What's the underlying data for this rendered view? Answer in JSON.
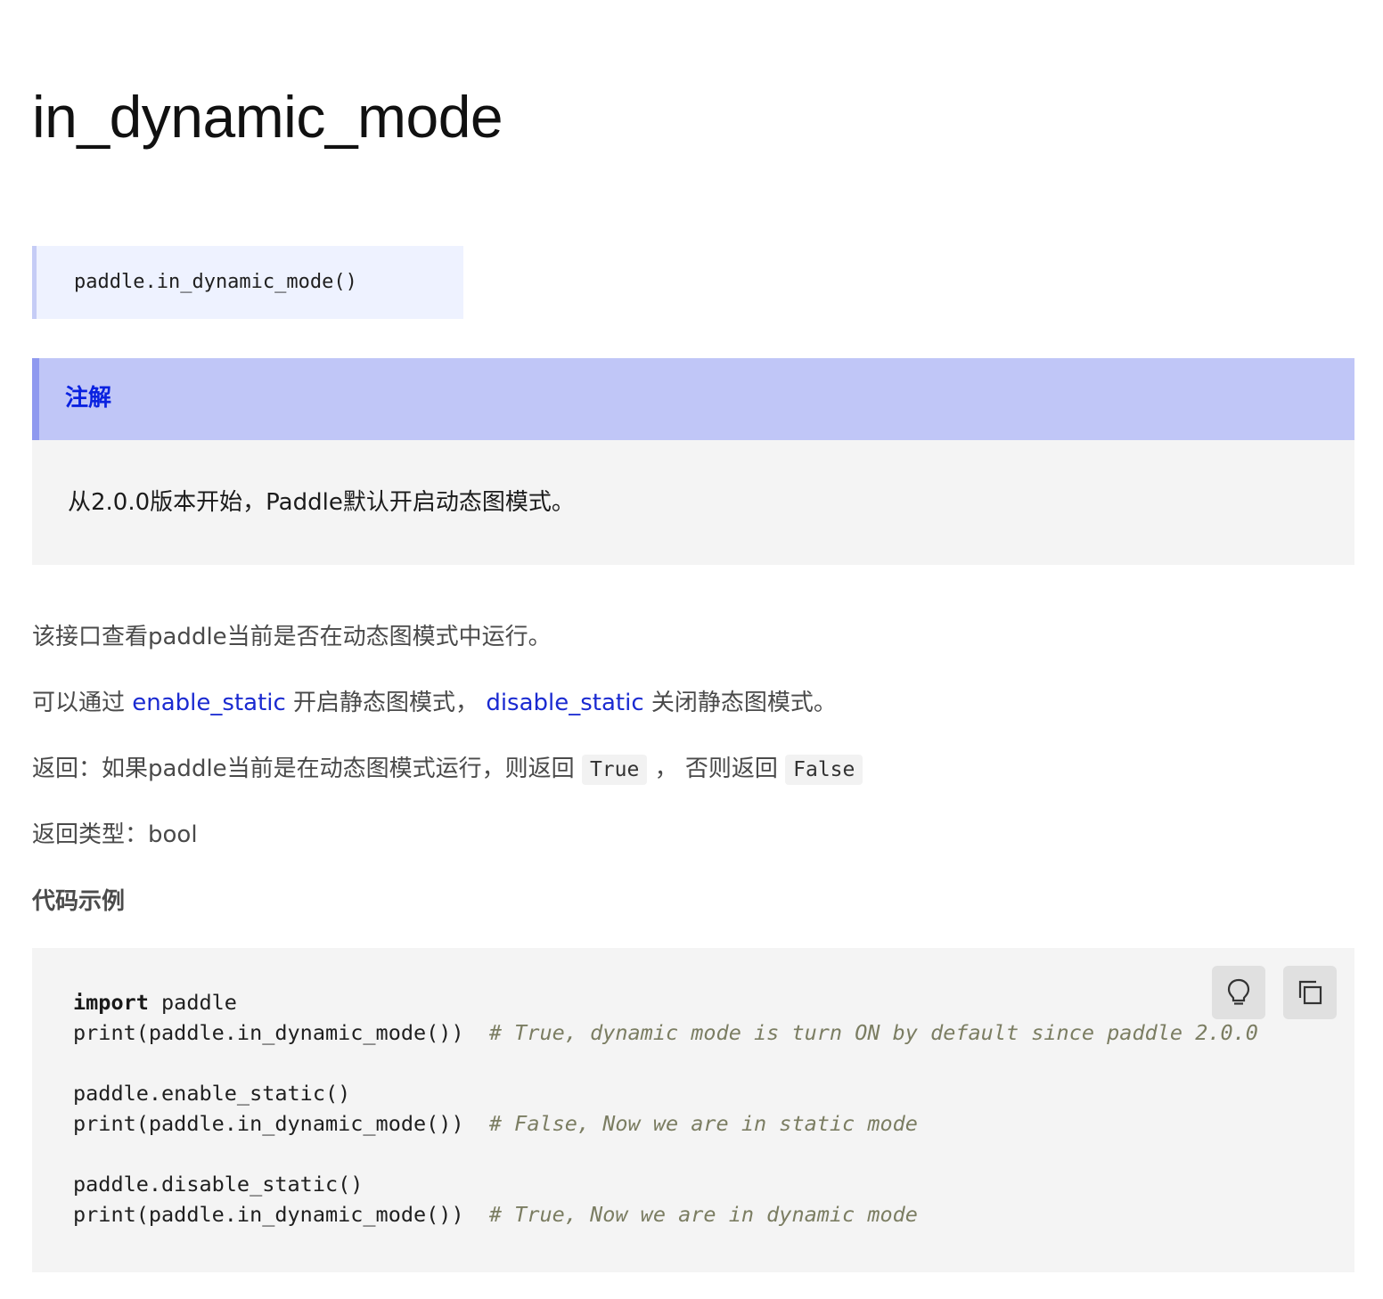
{
  "title": "in_dynamic_mode",
  "signature": "paddle.in_dynamic_mode()",
  "note": {
    "heading": "注解",
    "body": "从2.0.0版本开始，Paddle默认开启动态图模式。"
  },
  "description": "该接口查看paddle当前是否在动态图模式中运行。",
  "toggle_line": {
    "prefix": "可以通过 ",
    "link_enable": "enable_static",
    "middle": " 开启静态图模式， ",
    "link_disable": "disable_static",
    "suffix": " 关闭静态图模式。"
  },
  "returns_line": {
    "prefix": "返回：如果paddle当前是在动态图模式运行，则返回 ",
    "true_code": "True",
    "middle": " ， 否则返回 ",
    "false_code": "False"
  },
  "return_type_line": "返回类型：bool",
  "example_heading": "代码示例",
  "code": {
    "line1_kw": "import",
    "line1_rest": " paddle",
    "line2_code": "print(paddle.in_dynamic_mode())  ",
    "line2_comment": "# True, dynamic mode is turn ON by default since paddle 2.0.0",
    "line3_code": "paddle.enable_static()",
    "line4_code": "print(paddle.in_dynamic_mode())  ",
    "line4_comment": "# False, Now we are in static mode",
    "line5_code": "paddle.disable_static()",
    "line6_code": "print(paddle.in_dynamic_mode())  ",
    "line6_comment": "# True, Now we are in dynamic mode",
    "buttons": {
      "hint_icon": "lightbulb-icon",
      "copy_icon": "copy-icon"
    }
  }
}
